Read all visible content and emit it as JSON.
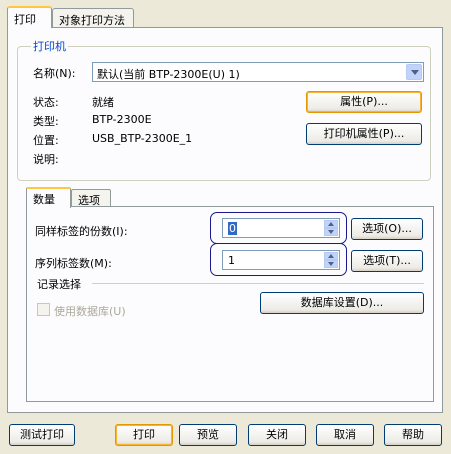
{
  "tabs": [
    "打印",
    "对象打印方法"
  ],
  "printer_group": {
    "title": "打印机",
    "name_label": "名称(N):",
    "name_value": "默认(当前 BTP-2300E(U) 1)",
    "status_label": "状态:",
    "status_value": "就绪",
    "type_label": "类型:",
    "type_value": "BTP-2300E",
    "location_label": "位置:",
    "location_value": "USB_BTP-2300E_1",
    "comment_label": "说明:",
    "properties_button": "属性(P)...",
    "printer_properties_button": "打印机属性(P)..."
  },
  "inner_tabs": [
    "数量",
    "选项"
  ],
  "quantity": {
    "copies_label": "同样标签的份数(I):",
    "copies_value": "0",
    "copies_options_button": "选项(O)...",
    "serial_label": "序列标签数(M):",
    "serial_value": "1",
    "serial_options_button": "选项(T)..."
  },
  "records": {
    "title": "记录选择",
    "use_database_label": "使用数据库(U)",
    "database_settings_button": "数据库设置(D)..."
  },
  "bottom_buttons": [
    "测试打印",
    "打印",
    "预览",
    "关闭",
    "取消",
    "帮助"
  ]
}
